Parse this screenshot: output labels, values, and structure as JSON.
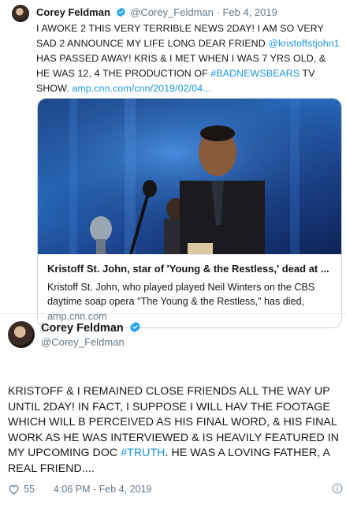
{
  "tweet_quoted": {
    "display_name": "Corey Feldman",
    "handle": "@Corey_Feldman",
    "separator": "·",
    "date": "Feb 4, 2019",
    "text_1": "I AWOKE 2 THIS VERY TERRIBLE NEWS 2DAY! I AM SO VERY SAD 2 ANNOUNCE MY LIFE LONG DEAR FRIEND ",
    "mention": "@kristoffstjohn1",
    "text_2": " HAS PASSED AWAY! KRIS & I MET WHEN I WAS 7 YRS OLD, & HE WAS 12, 4 THE PRODUCTION OF ",
    "hashtag": "#BADNEWSBEARS",
    "text_3": " TV SHOW.  ",
    "link": "amp.cnn.com/cnn/2019/02/04...",
    "card": {
      "title": "Kristoff St. John, star of 'Young & the Restless,' dead at ...",
      "description": "Kristoff St. John, who played played Neil Winters on the CBS daytime soap opera \"The Young & the Restless,\" has died,",
      "domain": "amp.cnn.com"
    }
  },
  "tweet_main": {
    "display_name": "Corey Feldman",
    "handle": "@Corey_Feldman",
    "text_1": "KRISTOFF & I REMAINED CLOSE FRIENDS ALL THE WAY UP UNTIL 2DAY! IN FACT, I SUPPOSE I WILL HAV THE FOOTAGE WHICH WILL B PERCEIVED AS HIS FINAL WORD, & HIS FINAL WORK AS HE WAS INTERVIEWED & IS HEAVILY FEATURED IN MY UPCOMING DOC ",
    "hashtag": "#TRUTH",
    "text_2": ". HE WAS A LOVING FATHER, A REAL FRIEND....",
    "likes": "55",
    "timestamp": "4:06 PM - Feb 4, 2019"
  },
  "colors": {
    "link": "#1b95e0",
    "verified": "#1da1f2",
    "muted": "#657786"
  },
  "icons": [
    "verified-badge-icon",
    "heart-icon",
    "info-icon"
  ]
}
